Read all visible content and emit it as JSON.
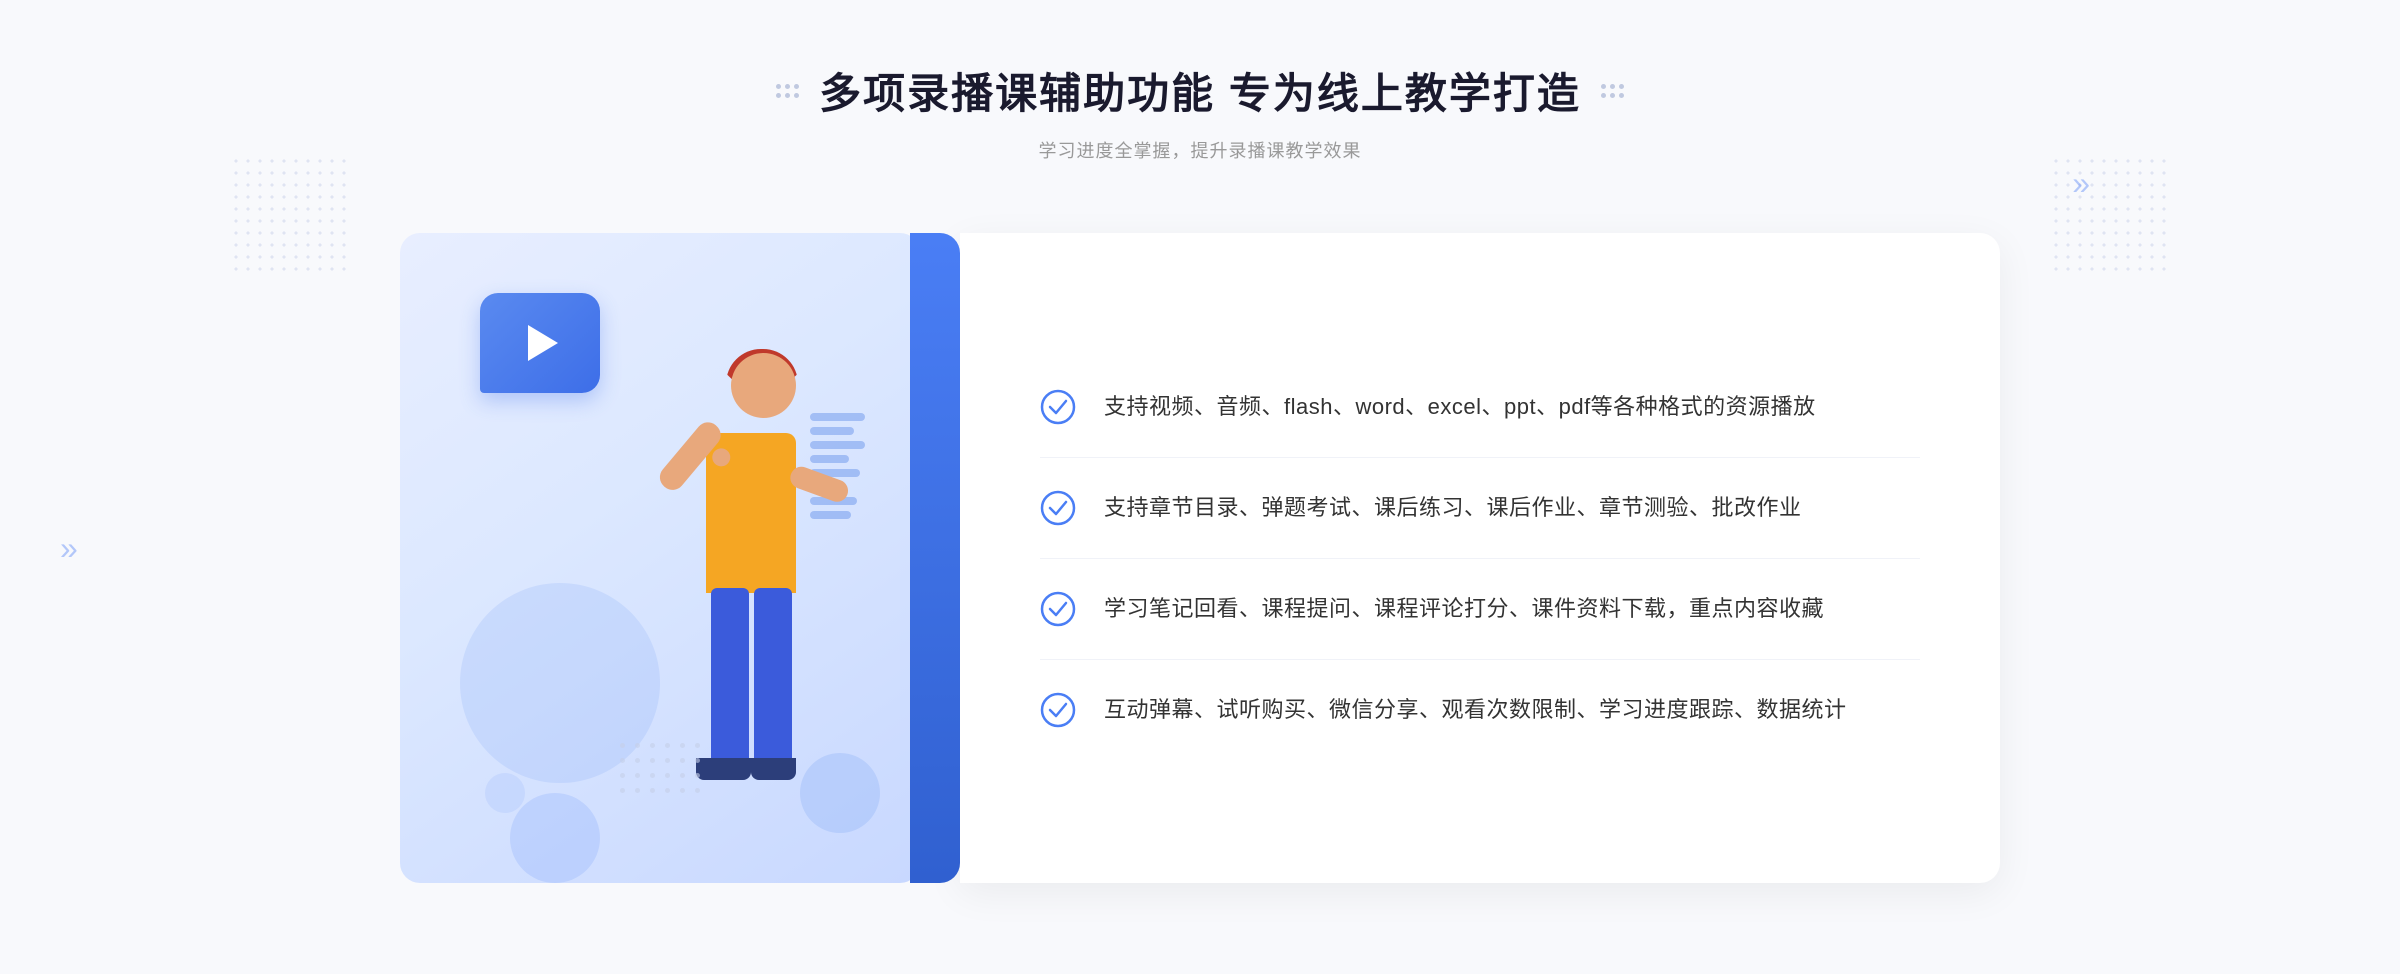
{
  "header": {
    "title": "多项录播课辅助功能 专为线上教学打造",
    "subtitle": "学习进度全掌握，提升录播课教学效果"
  },
  "features": [
    {
      "id": "feature-1",
      "text": "支持视频、音频、flash、word、excel、ppt、pdf等各种格式的资源播放"
    },
    {
      "id": "feature-2",
      "text": "支持章节目录、弹题考试、课后练习、课后作业、章节测验、批改作业"
    },
    {
      "id": "feature-3",
      "text": "学习笔记回看、课程提问、课程评论打分、课件资料下载，重点内容收藏"
    },
    {
      "id": "feature-4",
      "text": "互动弹幕、试听购买、微信分享、观看次数限制、学习进度跟踪、数据统计"
    }
  ],
  "decorations": {
    "chevron_left": "»",
    "chevron_right": "»"
  }
}
